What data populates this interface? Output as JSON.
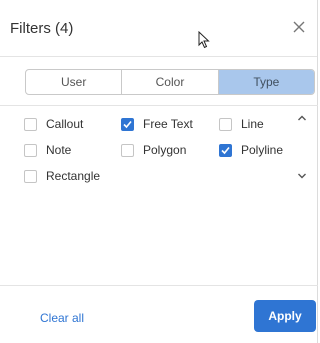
{
  "header": {
    "title": "Filters (4)"
  },
  "tabs": [
    {
      "label": "User",
      "active": false
    },
    {
      "label": "Color",
      "active": false
    },
    {
      "label": "Type",
      "active": true
    }
  ],
  "options": [
    {
      "label": "Callout",
      "checked": false
    },
    {
      "label": "Free Text",
      "checked": true
    },
    {
      "label": "Line",
      "checked": false
    },
    {
      "label": "Note",
      "checked": false
    },
    {
      "label": "Polygon",
      "checked": false
    },
    {
      "label": "Polyline",
      "checked": true
    },
    {
      "label": "Rectangle",
      "checked": false
    }
  ],
  "footer": {
    "clear_label": "Clear all",
    "apply_label": "Apply"
  },
  "icons": {
    "close": "close-icon",
    "scroll_up": "chevron-up-icon",
    "scroll_down": "chevron-down-icon",
    "cursor": "mouse-cursor-icon",
    "check": "checkmark-icon"
  },
  "colors": {
    "accent": "#2f75d3",
    "active_tab": "#a9c7ec"
  }
}
